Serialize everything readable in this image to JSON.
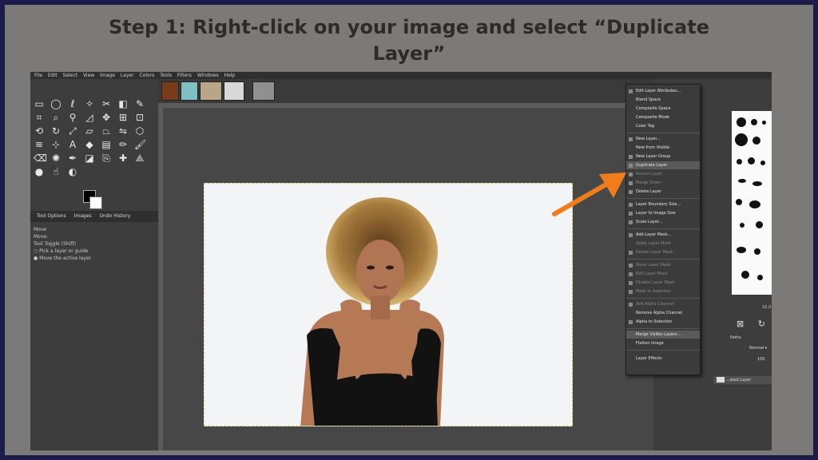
{
  "headline": {
    "line1": "Step 1: Right-click on your image and select “Duplicate",
    "line2": "Layer”"
  },
  "menubar": [
    "File",
    "Edit",
    "Select",
    "View",
    "Image",
    "Layer",
    "Colors",
    "Tools",
    "Filters",
    "Windows",
    "Help"
  ],
  "tool_options": {
    "tabs": [
      "Tool Options",
      "Images",
      "Undo History"
    ],
    "title": "Move",
    "move_label": "Move:",
    "tool_toggle": "Tool Toggle  (Shift)",
    "option1": "Pick a layer or guide",
    "option2": "Move the active layer"
  },
  "context_menu": {
    "items": [
      {
        "label": "Edit Layer Attributes...",
        "enabled": true
      },
      {
        "label": "Blend Space",
        "enabled": true
      },
      {
        "label": "Composite Space",
        "enabled": true
      },
      {
        "label": "Composite Mode",
        "enabled": true
      },
      {
        "label": "Color Tag",
        "enabled": true
      },
      {
        "label": "New Layer...",
        "enabled": true
      },
      {
        "label": "New from Visible",
        "enabled": true
      },
      {
        "label": "New Layer Group",
        "enabled": true
      },
      {
        "label": "Duplicate Layer",
        "enabled": true
      },
      {
        "label": "Anchor Layer",
        "enabled": false
      },
      {
        "label": "Merge Down",
        "enabled": false
      },
      {
        "label": "Delete Layer",
        "enabled": true
      },
      {
        "label": "Layer Boundary Size...",
        "enabled": true
      },
      {
        "label": "Layer to Image Size",
        "enabled": true
      },
      {
        "label": "Scale Layer...",
        "enabled": true
      },
      {
        "label": "Add Layer Mask...",
        "enabled": true
      },
      {
        "label": "Apply Layer Mask",
        "enabled": false
      },
      {
        "label": "Delete Layer Mask",
        "enabled": false
      },
      {
        "label": "Show Layer Mask",
        "enabled": false
      },
      {
        "label": "Edit Layer Mask",
        "enabled": false
      },
      {
        "label": "Disable Layer Mask",
        "enabled": false
      },
      {
        "label": "Mask to Selection",
        "enabled": false
      },
      {
        "label": "Add Alpha Channel",
        "enabled": false
      },
      {
        "label": "Remove Alpha Channel",
        "enabled": true
      },
      {
        "label": "Alpha to Selection",
        "enabled": true
      },
      {
        "label": "Merge Visible Layers...",
        "enabled": true
      },
      {
        "label": "Flatten Image",
        "enabled": true
      },
      {
        "label": "Layer Effects",
        "enabled": true
      }
    ]
  },
  "layers_panel": {
    "mode": "Normal",
    "opacity": "100",
    "layer_name": "...ated Layer",
    "tab_paths": "Paths",
    "zoom": "10.0"
  },
  "colors": {
    "frame": "#1b1c49",
    "background": "#7b7a78",
    "arrow": "#f07c1c"
  }
}
